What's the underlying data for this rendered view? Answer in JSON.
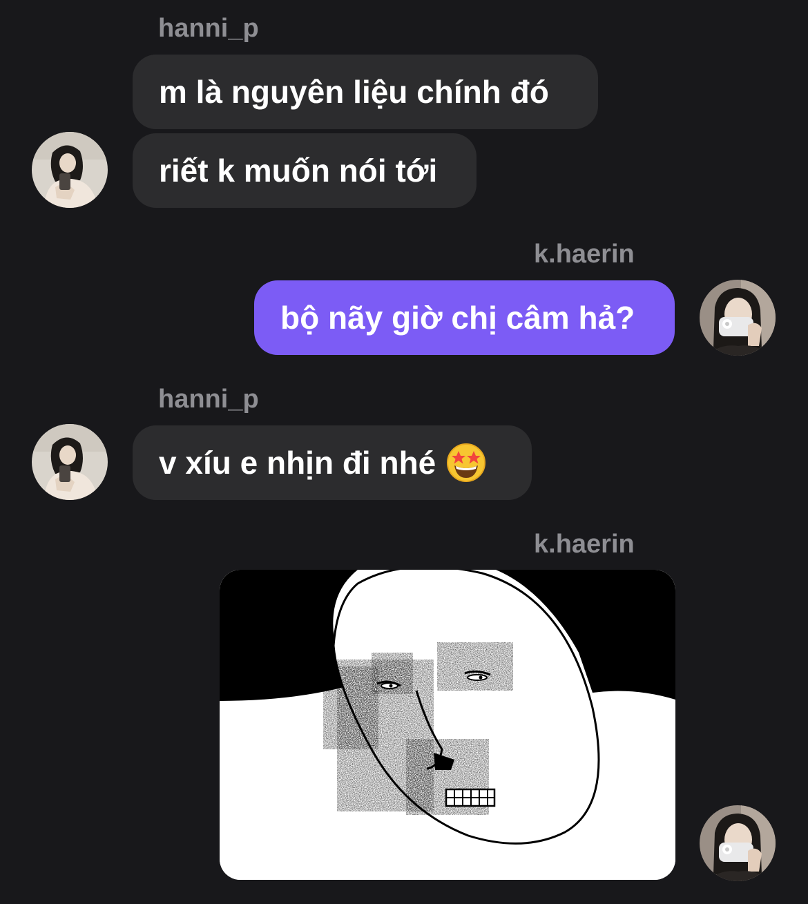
{
  "messages": [
    {
      "sender": "hanni_p",
      "lines": [
        "m là nguyên liệu chính đó",
        "riết k muốn nói tới"
      ]
    },
    {
      "sender": "k.haerin",
      "lines": [
        "bộ nãy giờ chị câm hả?"
      ]
    },
    {
      "sender": "hanni_p",
      "lines": [
        "v xíu e nhịn đi nhé"
      ],
      "emoji": "star-struck-emoji"
    },
    {
      "sender": "k.haerin",
      "image": "meme-face-drawing"
    }
  ],
  "colors": {
    "background": "#18181b",
    "incoming_bubble": "#2c2c2e",
    "outgoing_bubble": "#7c5cf5",
    "sender_name": "#8e8e93",
    "text": "#ffffff"
  },
  "icons": {
    "hanni_avatar": "avatar-photo-hanni",
    "haerin_avatar": "avatar-photo-haerin"
  }
}
